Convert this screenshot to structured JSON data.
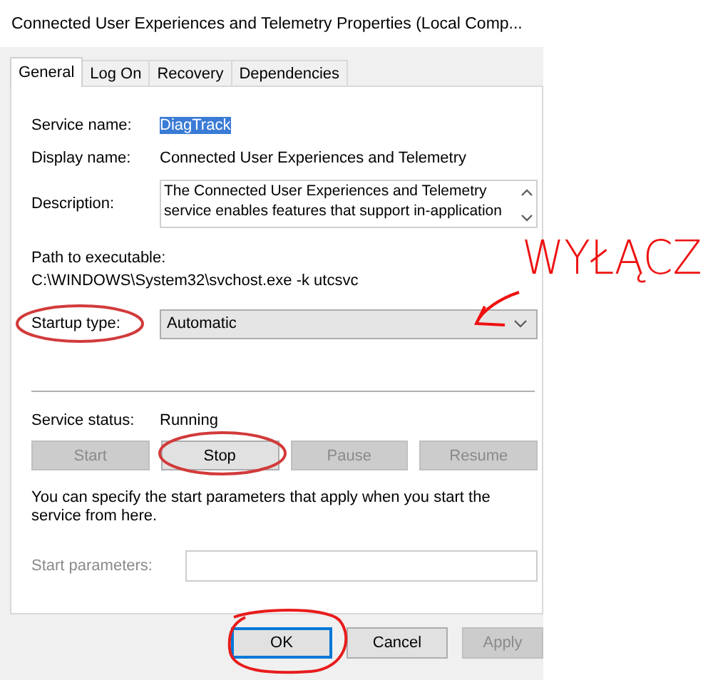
{
  "window": {
    "title": "Connected User Experiences and Telemetry Properties (Local Comp..."
  },
  "tabs": [
    {
      "label": "General",
      "selected": true
    },
    {
      "label": "Log On",
      "selected": false
    },
    {
      "label": "Recovery",
      "selected": false
    },
    {
      "label": "Dependencies",
      "selected": false
    }
  ],
  "service_name": {
    "label": "Service name:",
    "value": "DiagTrack",
    "selected": true
  },
  "display_name": {
    "label": "Display name:",
    "value": "Connected User Experiences and Telemetry"
  },
  "description": {
    "label": "Description:",
    "lines": [
      "The Connected User Experiences and Telemetry",
      "service enables features that support in-application"
    ]
  },
  "path": {
    "label": "Path to executable:",
    "value": "C:\\WINDOWS\\System32\\svchost.exe -k utcsvc"
  },
  "startup_type": {
    "label": "Startup type:",
    "value": "Automatic"
  },
  "service_status": {
    "label": "Service status:",
    "value": "Running"
  },
  "service_buttons": [
    {
      "label": "Start",
      "disabled": true
    },
    {
      "label": "Stop",
      "disabled": false
    },
    {
      "label": "Pause",
      "disabled": true
    },
    {
      "label": "Resume",
      "disabled": true
    }
  ],
  "note": "You can specify the start parameters that apply when you start the service from here.",
  "start_parameters": {
    "label": "Start parameters:",
    "disabled": true
  },
  "dialog_buttons": [
    {
      "label": "OK",
      "disabled": false,
      "default": true
    },
    {
      "label": "Cancel",
      "disabled": false,
      "default": false
    },
    {
      "label": "Apply",
      "disabled": true,
      "default": false
    }
  ],
  "annotation": {
    "text": "WYŁĄCZ"
  }
}
